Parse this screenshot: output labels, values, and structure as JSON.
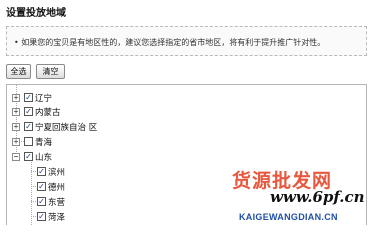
{
  "page": {
    "title": "设置投放地域",
    "notice": "• 如果您的宝贝是有地区性的，建议您选择指定的省市地区，将有利于提升推广针对性。"
  },
  "buttons": {
    "select_all": "全选",
    "clear": "清空"
  },
  "tree": {
    "provinces": [
      {
        "label": "辽宁",
        "expanded": false,
        "checked": true
      },
      {
        "label": "内蒙古",
        "expanded": false,
        "checked": true
      },
      {
        "label": "宁夏回族自治 区",
        "expanded": false,
        "checked": true
      },
      {
        "label": "青海",
        "expanded": false,
        "checked": false
      },
      {
        "label": "山东",
        "expanded": true,
        "checked": true
      }
    ],
    "cities": [
      {
        "label": "滨州",
        "checked": true
      },
      {
        "label": "德州",
        "checked": true
      },
      {
        "label": "东营",
        "checked": true
      },
      {
        "label": "菏泽",
        "checked": true
      }
    ]
  },
  "watermark": {
    "text_cn": "货源批发网",
    "url": "www.6pf.cn",
    "domain": "KAIGEWANGDIAN.CN"
  },
  "colors": {
    "checkbox_mark": "#203a8c",
    "watermark_red": "#e43a1d",
    "watermark_blue": "#1f4fa8"
  }
}
